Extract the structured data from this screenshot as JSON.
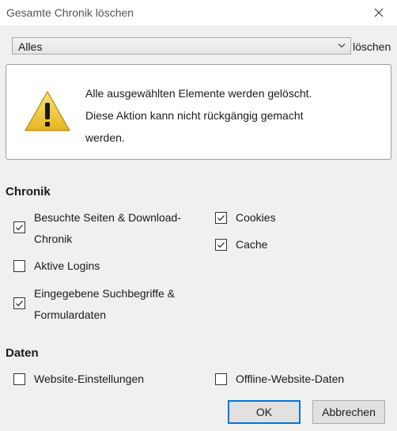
{
  "window": {
    "title": "Gesamte Chronik löschen"
  },
  "range": {
    "selected": "Alles",
    "suffix": "löschen"
  },
  "warning": {
    "lines": [
      "Alle ausgewählten Elemente werden gelöscht.",
      "Diese Aktion kann nicht rückgängig gemacht",
      "werden."
    ]
  },
  "chronik": {
    "title": "Chronik",
    "items": [
      {
        "line1": "Besuchte Seiten & Download-",
        "line2": "Chronik",
        "checked": true
      },
      {
        "line1": "Aktive Logins",
        "line2": "",
        "checked": false
      },
      {
        "line1": "Eingegebene Suchbegriffe &",
        "line2": "Formulardaten",
        "checked": true
      },
      {
        "line1": "Cookies",
        "line2": "",
        "checked": true
      },
      {
        "line1": "Cache",
        "line2": "",
        "checked": true
      }
    ]
  },
  "daten": {
    "title": "Daten",
    "items": [
      {
        "line1": "Website-Einstellungen",
        "checked": false
      },
      {
        "line1": "Offline-Website-Daten",
        "checked": false
      }
    ]
  },
  "buttons": {
    "ok": "OK",
    "cancel": "Abbrechen"
  }
}
